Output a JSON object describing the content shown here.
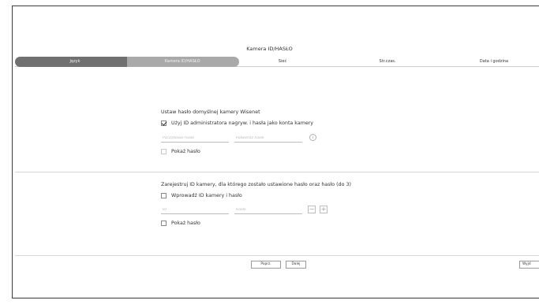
{
  "window": {
    "title": "Kamera ID/HASŁO"
  },
  "steps": [
    {
      "label": "Język"
    },
    {
      "label": "Kamera ID/HASŁO"
    },
    {
      "label": "Sieć"
    },
    {
      "label": "Str.czas."
    },
    {
      "label": "Data i godzina"
    }
  ],
  "section1": {
    "title": "Ustaw hasło domyślnej kamery Wisenet",
    "use_admin_checkbox_label": "Użyj ID administratora nagryw. i hasła jako konta kamery",
    "use_admin_checked": true,
    "initial_password_placeholder": "Początkowe hasło",
    "confirm_password_placeholder": "Potwierdź hasło",
    "show_password_label": "Pokaż hasło",
    "info_icon_glyph": "i"
  },
  "section2": {
    "title": "Zarejestruj ID kamery, dla którego zostało ustawione hasło oraz hasło (do 3)",
    "enter_id_checkbox_label": "Wprowadź ID kamery i hasło",
    "id_placeholder": "ID",
    "password_placeholder": "Hasło",
    "minus_glyph": "−",
    "plus_glyph": "+",
    "show_password_label": "Pokaż hasło"
  },
  "footer": {
    "prev_label": "Poprz.",
    "next_label": "Dalej",
    "exit_label": "Wyjd"
  }
}
